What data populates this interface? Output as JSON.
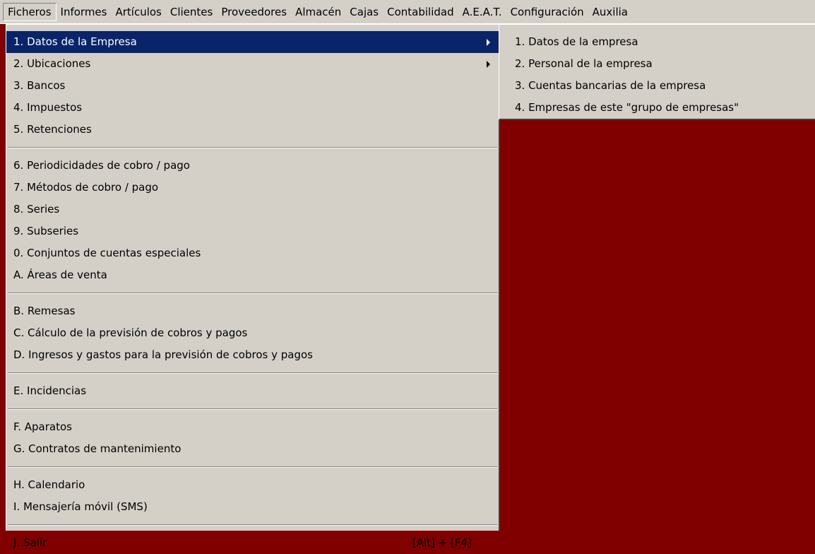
{
  "menubar": {
    "items": [
      "Ficheros",
      "Informes",
      "Artículos",
      "Clientes",
      "Proveedores",
      "Almacén",
      "Cajas",
      "Contabilidad",
      "A.E.A.T.",
      "Configuración",
      "Auxilia"
    ]
  },
  "ficheros_menu": {
    "groups": [
      [
        {
          "label": "1. Datos de la Empresa",
          "submenu": true,
          "highlighted": true
        },
        {
          "label": "2. Ubicaciones",
          "submenu": true
        },
        {
          "label": "3. Bancos"
        },
        {
          "label": "4. Impuestos"
        },
        {
          "label": "5. Retenciones"
        }
      ],
      [
        {
          "label": "6. Periodicidades de cobro / pago"
        },
        {
          "label": "7. Métodos de cobro / pago"
        },
        {
          "label": "8. Series"
        },
        {
          "label": "9. Subseries"
        },
        {
          "label": "0. Conjuntos de cuentas especiales"
        },
        {
          "label": "A. Áreas de venta"
        }
      ],
      [
        {
          "label": "B. Remesas"
        },
        {
          "label": "C. Cálculo de la previsión de cobros y pagos"
        },
        {
          "label": "D. Ingresos y gastos para la previsión de cobros y pagos"
        }
      ],
      [
        {
          "label": "E. Incidencias"
        }
      ],
      [
        {
          "label": "F. Aparatos"
        },
        {
          "label": "G. Contratos de mantenimiento"
        }
      ],
      [
        {
          "label": "H. Calendario"
        },
        {
          "label": "I. Mensajería móvil (SMS)"
        }
      ],
      [
        {
          "label": "J.  Salir",
          "shortcut": "[Alt] + [F4]"
        }
      ]
    ]
  },
  "datos_empresa_submenu": {
    "items": [
      "1. Datos de la empresa",
      "2. Personal de la empresa",
      "3. Cuentas bancarias de la empresa",
      "4. Empresas de este \"grupo de empresas\""
    ]
  },
  "colors": {
    "desktop": "#800000",
    "menu_bg": "#d4d0c8",
    "highlight": "#0a246a"
  }
}
